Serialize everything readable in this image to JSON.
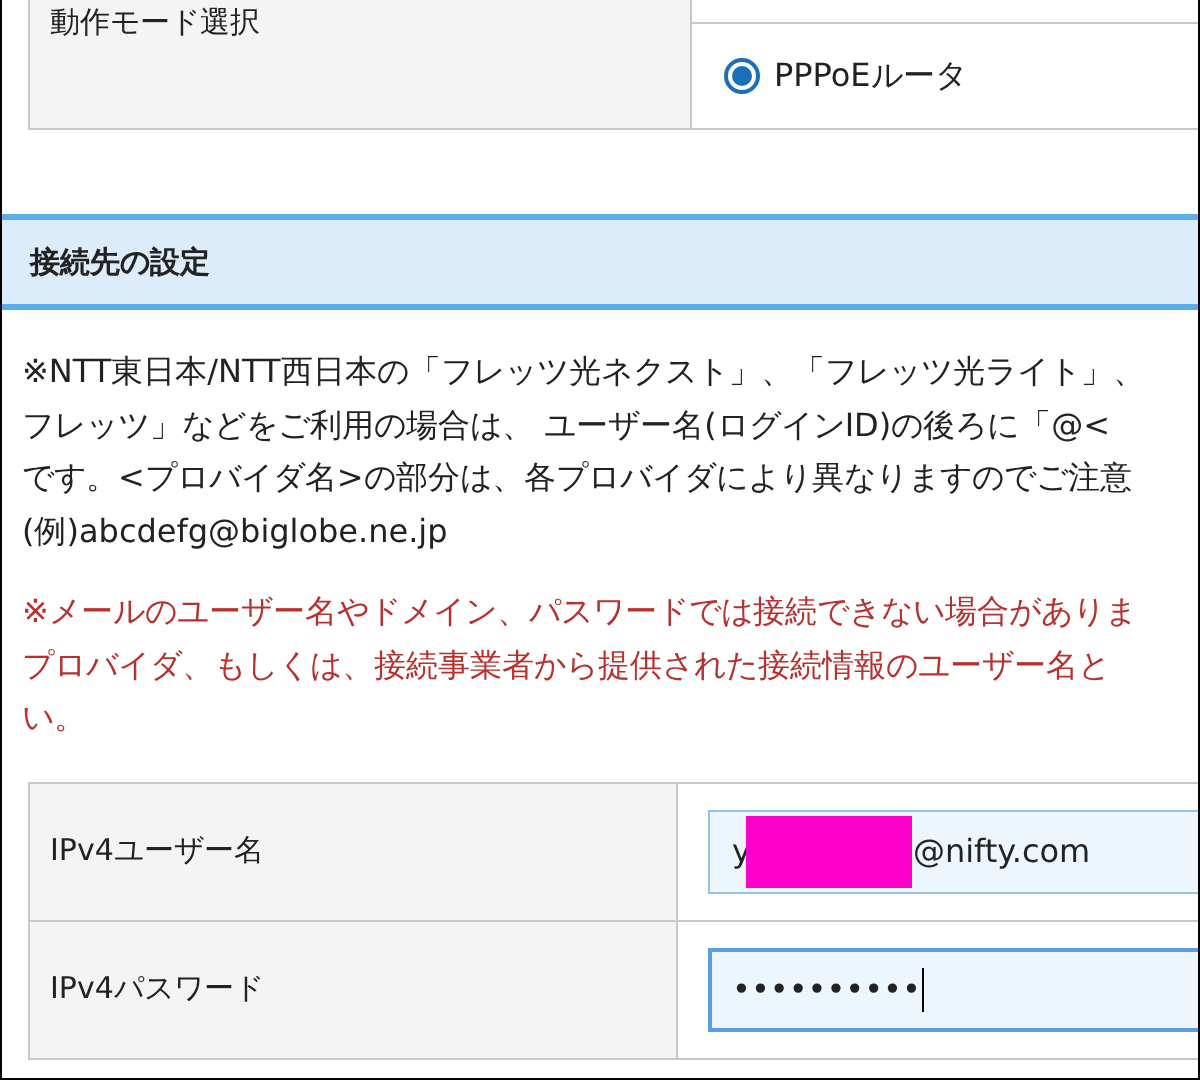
{
  "mode_table": {
    "label": "動作モード選択",
    "options": [
      {
        "label": "PPPoEルータ",
        "selected": true
      }
    ]
  },
  "section": {
    "title": "接続先の設定"
  },
  "notes": [
    {
      "kind": "info",
      "lines": [
        "※NTT東日本/NTT西日本の「フレッツ光ネクスト」、「フレッツ光ライト」、",
        "フレッツ」などをご利用の場合は、 ユーザー名(ログインID)の後ろに「@<",
        "です。<プロバイダ名>の部分は、各プロバイダにより異なりますのでご注意",
        "(例)abcdefg@biglobe.ne.jp"
      ]
    },
    {
      "kind": "warning",
      "lines": [
        "※メールのユーザー名やドメイン、パスワードでは接続できない場合がありま",
        "プロバイダ、もしくは、接続事業者から提供された接続情報のユーザー名と",
        "い。"
      ]
    }
  ],
  "fields": [
    {
      "label": "IPv4ユーザー名",
      "value_prefix": "y",
      "redacted": true,
      "value_suffix": "@nifty.com",
      "focused": false
    },
    {
      "label": "IPv4パスワード",
      "value_prefix": "••••••••••",
      "focused": true
    }
  ]
}
